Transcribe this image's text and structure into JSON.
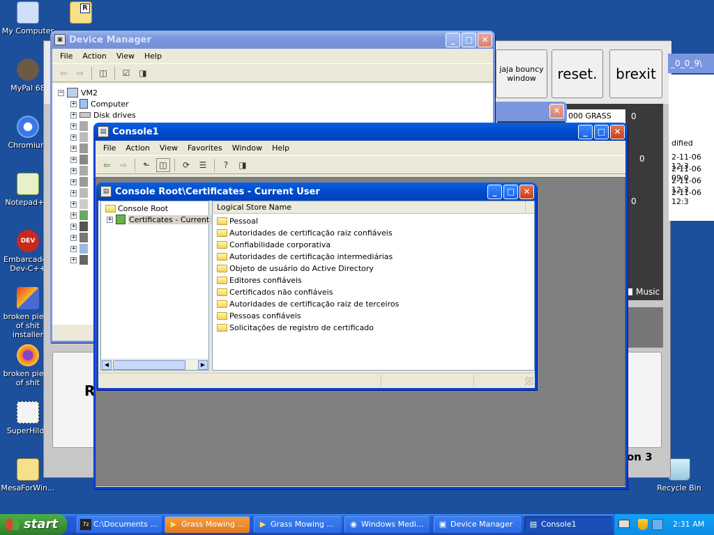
{
  "desktop": {
    "icons": [
      {
        "label": "My Computer",
        "color": "#cfe0f8"
      },
      {
        "label": "MyPal 68",
        "color": "#6b5a44"
      },
      {
        "label": "Chromium",
        "color": "#3b78e7"
      },
      {
        "label": "Notepad++",
        "color": "#9ccf6a"
      },
      {
        "label": "Embarcadero Dev-C++",
        "color": "#c8281e"
      },
      {
        "label": "broken piece of shit installer",
        "color": "#4a6ad0"
      },
      {
        "label": "broken piece of shit",
        "color": "#f07820"
      },
      {
        "label": "SuperHilda",
        "color": "#f4f4f4"
      },
      {
        "label": "MesaForWin...",
        "color": "#f6e08a"
      }
    ],
    "recycle_bin": "Recycle Bin"
  },
  "grass_window": {
    "buttons": [
      "jaja bouncy window",
      "reset.",
      "brexit"
    ],
    "path_fragment": "_0_0_9\\",
    "counter_label": "000 GRASS",
    "zeros": [
      "0",
      "0",
      "0"
    ],
    "modified_header": "dified",
    "dates": [
      "2-11-06 12:3",
      "2-11-06 09:0",
      "2-11-06 12:3",
      "2-11-06 12:3"
    ],
    "music_label": "Music",
    "section_text": "on 3",
    "r_text": "R"
  },
  "device_manager": {
    "title": "Device Manager",
    "menu": [
      "File",
      "Action",
      "View",
      "Help"
    ],
    "root": "VM2",
    "items": [
      "Computer",
      "Disk drives"
    ]
  },
  "console": {
    "title": "Console1",
    "menu": [
      "File",
      "Action",
      "View",
      "Favorites",
      "Window",
      "Help"
    ]
  },
  "cert_window": {
    "title": "Console Root\\Certificates - Current User",
    "tree_root": "Console Root",
    "tree_child": "Certificates - Current U",
    "column_header": "Logical Store Name",
    "stores": [
      "Pessoal",
      "Autoridades de certificação raiz confiáveis",
      "Confiabilidade corporativa",
      "Autoridades de certificação intermediárias",
      "Objeto de usuário do Active Directory",
      "Editores confiáveis",
      "Certificados não confiáveis",
      "Autoridades de certificação raiz de terceiros",
      "Pessoas confiáveis",
      "Solicitações de registro de certificado"
    ]
  },
  "taskbar": {
    "start": "start",
    "tasks": [
      {
        "label": "C:\\Documents ...",
        "icon": "7z"
      },
      {
        "label": "Grass Mowing ...",
        "icon": "▶"
      },
      {
        "label": "Grass Mowing ...",
        "icon": "▶"
      },
      {
        "label": "Windows Medi...",
        "icon": "◉"
      },
      {
        "label": "Device Manager",
        "icon": "▣"
      },
      {
        "label": "Console1",
        "icon": "▤"
      }
    ],
    "clock": "2:31 AM"
  }
}
